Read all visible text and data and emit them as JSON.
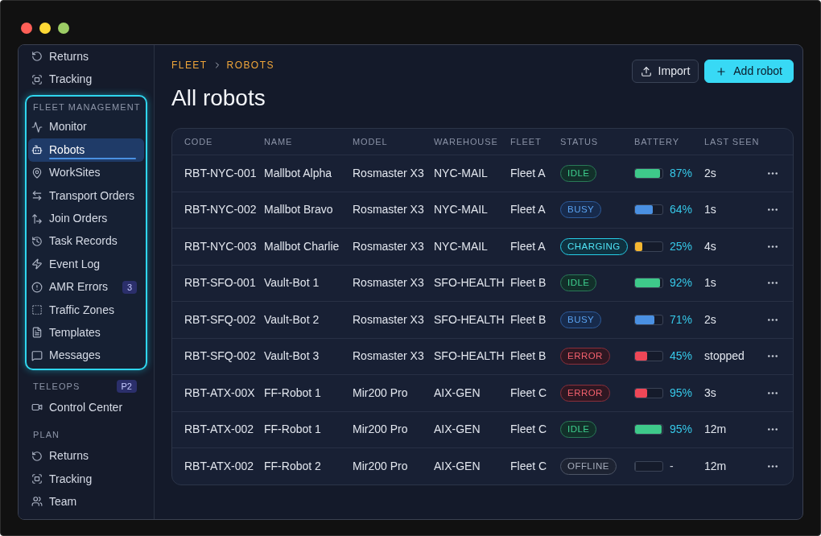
{
  "sidebar": {
    "sections": [
      {
        "highlighted": false,
        "items": [
          {
            "label": "Returns",
            "selected": false
          },
          {
            "label": "Tracking",
            "selected": false
          }
        ]
      },
      {
        "title": "FLEET MANAGEMENT",
        "highlighted": true,
        "items": [
          {
            "label": "Monitor",
            "selected": false
          },
          {
            "label": "Robots",
            "selected": true
          },
          {
            "label": "WorkSites",
            "selected": false
          },
          {
            "label": "Transport Orders",
            "selected": false
          },
          {
            "label": "Join Orders",
            "selected": false
          },
          {
            "label": "Task Records",
            "selected": false
          },
          {
            "label": "Event Log",
            "selected": false
          },
          {
            "label": "AMR Errors",
            "selected": false,
            "badge": "3"
          },
          {
            "label": "Traffic Zones",
            "selected": false
          },
          {
            "label": "Templates",
            "selected": false
          },
          {
            "label": "Messages",
            "selected": false
          }
        ]
      },
      {
        "title": "TELEOPS",
        "badge": "P2",
        "highlighted": false,
        "items": [
          {
            "label": "Control Center",
            "selected": false
          }
        ]
      },
      {
        "title": "PLAN",
        "highlighted": false,
        "items": [
          {
            "label": "Returns",
            "selected": false
          },
          {
            "label": "Tracking",
            "selected": false
          },
          {
            "label": "Team",
            "selected": false
          }
        ]
      }
    ]
  },
  "breadcrumb": [
    "FLEET",
    "ROBOTS"
  ],
  "page_title": "All robots",
  "actions": [
    {
      "label": "Import",
      "kind": "secondary"
    },
    {
      "label": "Add robot",
      "kind": "primary"
    }
  ],
  "table": {
    "columns": [
      "CODE",
      "NAME",
      "MODEL",
      "WAREHOUSE",
      "FLEET",
      "STATUS",
      "BATTERY",
      "LAST SEEN"
    ],
    "rows": [
      {
        "code": "RBT-NYC-001",
        "name": "Mallbot Alpha",
        "model": "Rosmaster X3",
        "warehouse": "NYC-MAIL",
        "fleet": "Fleet A",
        "status": {
          "label": "IDLE",
          "kind": "idle"
        },
        "battery": {
          "level": 0.9,
          "reading": "87%"
        },
        "last_seen": "2s"
      },
      {
        "code": "RBT-NYC-002",
        "name": "Mallbot Bravo",
        "model": "Rosmaster X3",
        "warehouse": "NYC-MAIL",
        "fleet": "Fleet A",
        "status": {
          "label": "BUSY",
          "kind": "busy"
        },
        "battery": {
          "level": 0.64,
          "reading": "64%"
        },
        "last_seen": "1s"
      },
      {
        "code": "RBT-NYC-003",
        "name": "Mallbot Charlie",
        "model": "Rosmaster X3",
        "warehouse": "NYC-MAIL",
        "fleet": "Fleet A",
        "status": {
          "label": "CHARGING",
          "kind": "charging"
        },
        "battery": {
          "level": 0.25,
          "reading": "25%"
        },
        "last_seen": "4s"
      },
      {
        "code": "RBT-SFO-001",
        "name": "Vault-Bot 1",
        "model": "Rosmaster X3",
        "warehouse": "SFO-HEALTH",
        "fleet": "Fleet B",
        "status": {
          "label": "IDLE",
          "kind": "idle"
        },
        "battery": {
          "level": 0.92,
          "reading": "92%"
        },
        "last_seen": "1s"
      },
      {
        "code": "RBT-SFQ-002",
        "name": "Vault-Bot 2",
        "model": "Rosmaster X3",
        "warehouse": "SFO-HEALTH",
        "fleet": "Fleet B",
        "status": {
          "label": "BUSY",
          "kind": "busy"
        },
        "battery": {
          "level": 0.71,
          "reading": "71%"
        },
        "last_seen": "2s"
      },
      {
        "code": "RBT-SFQ-002",
        "name": "Vault-Bot 3",
        "model": "Rosmaster X3",
        "warehouse": "SFO-HEALTH",
        "fleet": "Fleet B",
        "status": {
          "label": "ERROR",
          "kind": "error"
        },
        "battery": {
          "level": 0.45,
          "reading": "45%"
        },
        "last_seen": "stopped"
      },
      {
        "code": "RBT-ATX-00X",
        "name": "FF-Robot 1",
        "model": "Mir200 Pro",
        "warehouse": "AIX-GEN",
        "fleet": "Fleet C",
        "status": {
          "label": "ERROR",
          "kind": "error"
        },
        "battery": {
          "level": 0.45,
          "reading": "95%"
        },
        "last_seen": "3s"
      },
      {
        "code": "RBT-ATX-002",
        "name": "FF-Robot 1",
        "model": "Mir200 Pro",
        "warehouse": "AIX-GEN",
        "fleet": "Fleet C",
        "status": {
          "label": "IDLE",
          "kind": "idle"
        },
        "battery": {
          "level": 0.98,
          "reading": "95%"
        },
        "last_seen": "12m"
      },
      {
        "code": "RBT-ATX-002",
        "name": "FF-Robot 2",
        "model": "Mir200 Pro",
        "warehouse": "AIX-GEN",
        "fleet": "Fleet C",
        "status": {
          "label": "OFFLINE",
          "kind": "offline"
        },
        "battery": {
          "level": 0,
          "reading": "-"
        },
        "last_seen": "12m"
      }
    ]
  }
}
